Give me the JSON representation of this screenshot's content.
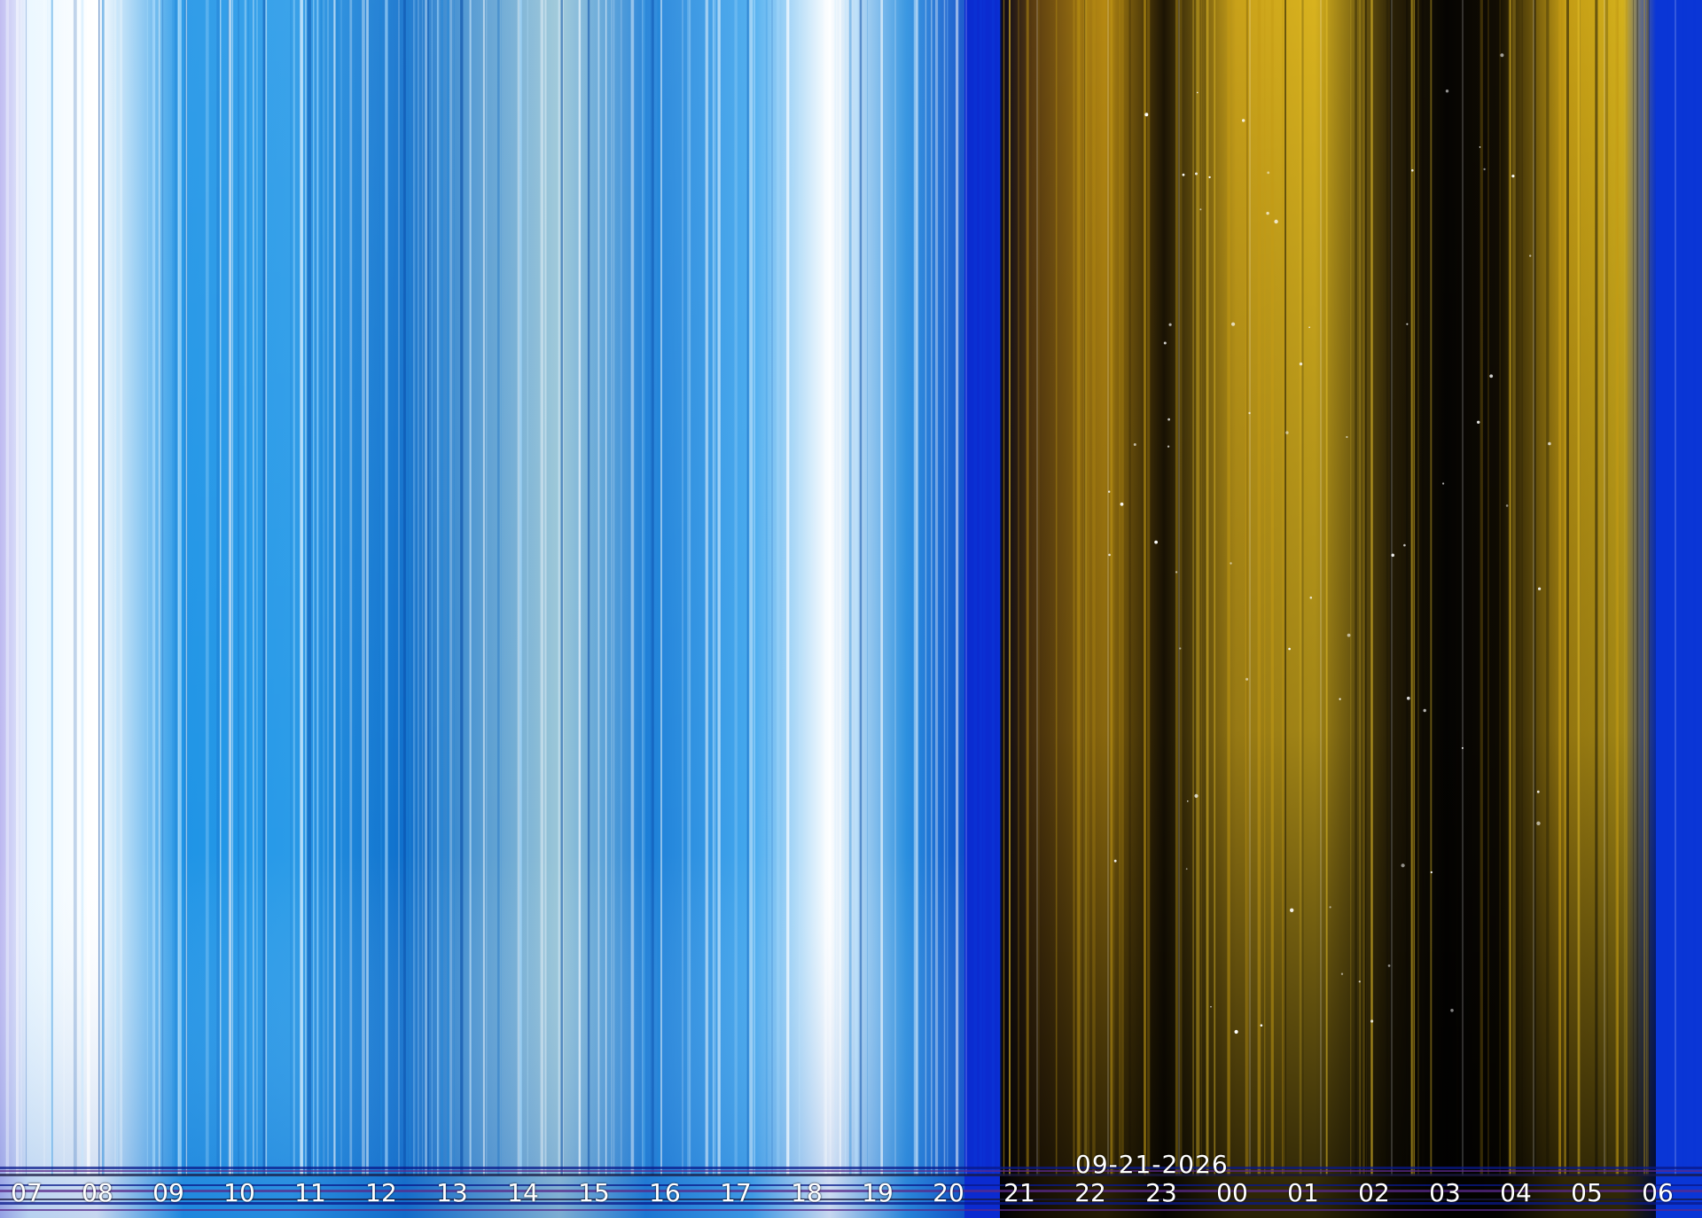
{
  "keogram": {
    "date": "09-21-2026",
    "hours": [
      "07",
      "08",
      "09",
      "10",
      "11",
      "12",
      "13",
      "14",
      "15",
      "16",
      "17",
      "18",
      "19",
      "20",
      "21",
      "22",
      "23",
      "00",
      "01",
      "02",
      "03",
      "04",
      "05",
      "06"
    ],
    "colors": {
      "day_sky": "#1f86d8",
      "day_light": "#bfe6ff",
      "night_gold": "#c49a14",
      "night_dark": "#0b0904",
      "edge_blue": "#0a36d6"
    }
  }
}
